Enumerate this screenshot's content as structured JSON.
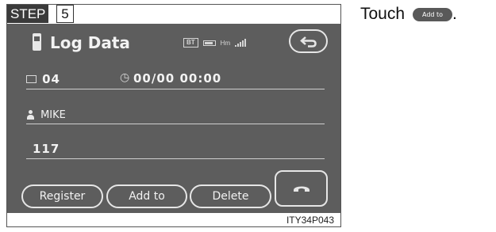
{
  "step": {
    "label": "STEP",
    "number": "5"
  },
  "screen": {
    "title": "Log Data",
    "status": {
      "bt": "BT",
      "hm": "Hm"
    },
    "entry_count": "04",
    "datetime": "00/00 00:00",
    "name": "MIKE",
    "number": "117",
    "buttons": {
      "register": "Register",
      "add_to": "Add to",
      "delete": "Delete"
    }
  },
  "caption": {
    "code": "ITY34P043"
  },
  "instruction": {
    "prefix": "Touch",
    "button": "Add to",
    "suffix": "."
  },
  "colors": {
    "screen_bg": "#5d5d5d",
    "screen_fg": "#f2f2f2",
    "step_bg": "#3a3a3a"
  }
}
